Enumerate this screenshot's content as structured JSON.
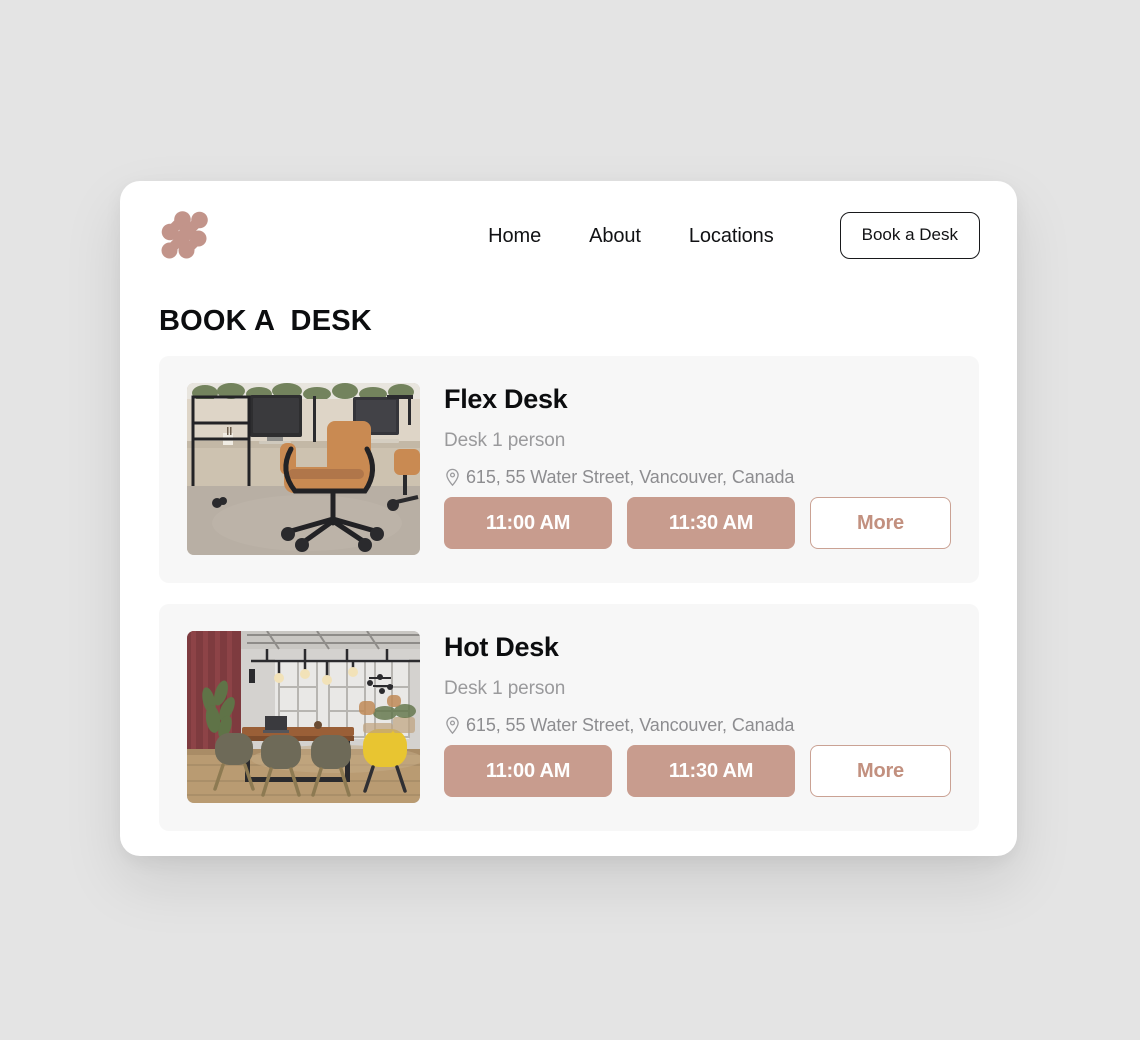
{
  "theme": {
    "page_background": "#E4E4E4",
    "window_background": "#FFFFFF",
    "card_background": "#F7F7F7",
    "accent": "#C89C8E",
    "accent_border": "#CAA294",
    "accent_text": "#C2907F",
    "text_primary": "#0C0D0F",
    "text_muted": "#9A9A9C"
  },
  "header": {
    "logo_name": "brand-logo",
    "nav": [
      {
        "label": "Home",
        "name": "nav-item-home"
      },
      {
        "label": "About",
        "name": "nav-item-about"
      },
      {
        "label": "Locations",
        "name": "nav-item-locations"
      }
    ],
    "cta_label": "Book a Desk"
  },
  "page_title": "BOOK A  DESK",
  "cards": [
    {
      "title": "Flex Desk",
      "subtitle": "Desk 1 person",
      "address": "615, 55 Water Street, Vancouver, Canada",
      "address_icon": "location-pin-icon",
      "image_alt": "office desks with tan leather rolling chair and monitors",
      "slots": [
        {
          "label": "11:00 AM",
          "style": "filled"
        },
        {
          "label": "11:30 AM",
          "style": "filled"
        }
      ],
      "more_label": "More"
    },
    {
      "title": "Hot Desk",
      "subtitle": "Desk 1 person",
      "address": "615, 55 Water Street, Vancouver, Canada",
      "address_icon": "location-pin-icon",
      "image_alt": "loft coworking space with long wooden table, burgundy curtain and yellow chair",
      "slots": [
        {
          "label": "11:00 AM",
          "style": "filled"
        },
        {
          "label": "11:30 AM",
          "style": "filled"
        }
      ],
      "more_label": "More"
    }
  ]
}
